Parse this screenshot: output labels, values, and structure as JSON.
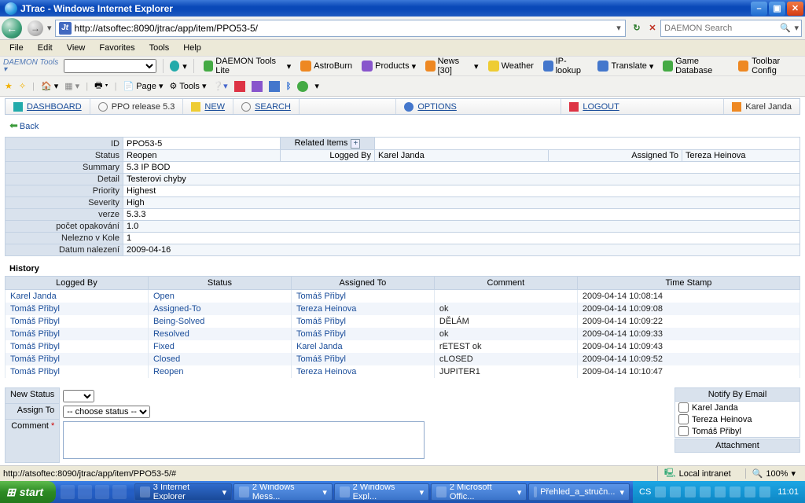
{
  "window": {
    "title": "JTrac - Windows Internet Explorer"
  },
  "address": {
    "url": "http://atsoftec:8090/jtrac/app/item/PPO53-5/"
  },
  "search": {
    "placeholder": "DAEMON Search"
  },
  "menus": [
    "File",
    "Edit",
    "View",
    "Favorites",
    "Tools",
    "Help"
  ],
  "daemon": {
    "label": "DAEMON Tools",
    "items": [
      "DAEMON Tools Lite",
      "AstroBurn",
      "Products",
      "News [30]",
      "Weather",
      "IP-lookup",
      "Translate",
      "Game Database"
    ],
    "config": "Toolbar Config"
  },
  "ietb": {
    "page": "Page",
    "tools": "Tools"
  },
  "jnav": {
    "dashboard": "DASHBOARD",
    "release": "PPO release 5.3",
    "new": "NEW",
    "search": "SEARCH",
    "options": "OPTIONS",
    "logout": "LOGOUT",
    "user": "Karel Janda"
  },
  "back": "Back",
  "item": {
    "labels": {
      "id": "ID",
      "relitems": "Related Items",
      "status": "Status",
      "loggedby": "Logged By",
      "assignedto": "Assigned To",
      "summary": "Summary",
      "detail": "Detail",
      "priority": "Priority",
      "severity": "Severity",
      "verze": "verze",
      "pocet": "počet opakování",
      "nelezno": "Nelezno v Kole",
      "datum": "Datum nalezení"
    },
    "id": "PPO53-5",
    "status": "Reopen",
    "loggedby": "Karel Janda",
    "assignedto": "Tereza Heinova",
    "summary": "5.3 IP BOD",
    "detail": "Testerovi chyby",
    "priority": "Highest",
    "severity": "High",
    "verze": "5.3.3",
    "pocet": "1.0",
    "nelezno": "1",
    "datum": "2009-04-16"
  },
  "history": {
    "title": "History",
    "cols": [
      "Logged By",
      "Status",
      "Assigned To",
      "Comment",
      "Time Stamp"
    ],
    "rows": [
      {
        "logged": "Karel Janda",
        "status": "Open",
        "assigned": "Tomáš Přibyl",
        "comment": "",
        "ts": "2009-04-14 10:08:14"
      },
      {
        "logged": "Tomáš Přibyl",
        "status": "Assigned-To",
        "assigned": "Tereza Heinova",
        "comment": "ok",
        "ts": "2009-04-14 10:09:08"
      },
      {
        "logged": "Tomáš Přibyl",
        "status": "Being-Solved",
        "assigned": "Tomáš Přibyl",
        "comment": "DĚLÁM",
        "ts": "2009-04-14 10:09:22"
      },
      {
        "logged": "Tomáš Přibyl",
        "status": "Resolved",
        "assigned": "Tomáš Přibyl",
        "comment": "ok",
        "ts": "2009-04-14 10:09:33"
      },
      {
        "logged": "Tomáš Přibyl",
        "status": "Fixed",
        "assigned": "Karel Janda",
        "comment": "rETEST ok",
        "ts": "2009-04-14 10:09:43"
      },
      {
        "logged": "Tomáš Přibyl",
        "status": "Closed",
        "assigned": "Tomáš Přibyl",
        "comment": "cLOSED",
        "ts": "2009-04-14 10:09:52"
      },
      {
        "logged": "Tomáš Přibyl",
        "status": "Reopen",
        "assigned": "Tereza Heinova",
        "comment": "JUPITER1",
        "ts": "2009-04-14 10:10:47"
      }
    ]
  },
  "form": {
    "newstatus": "New Status",
    "assignto": "Assign To",
    "assignopt": "-- choose status --",
    "comment": "Comment",
    "notify_title": "Notify By Email",
    "notify": [
      "Karel Janda",
      "Tereza Heinova",
      "Tomáš Přibyl"
    ],
    "attachment": "Attachment"
  },
  "status": {
    "text": "http://atsoftec:8090/jtrac/app/item/PPO53-5/#",
    "zone": "Local intranet",
    "zoom": "100%"
  },
  "taskbar": {
    "start": "start",
    "tasks": [
      "3 Internet Explorer",
      "2 Windows Mess...",
      "2 Windows Expl...",
      "2 Microsoft Offic...",
      "Přehled_a_stručn..."
    ],
    "lang": "CS",
    "clock": "11:01"
  }
}
